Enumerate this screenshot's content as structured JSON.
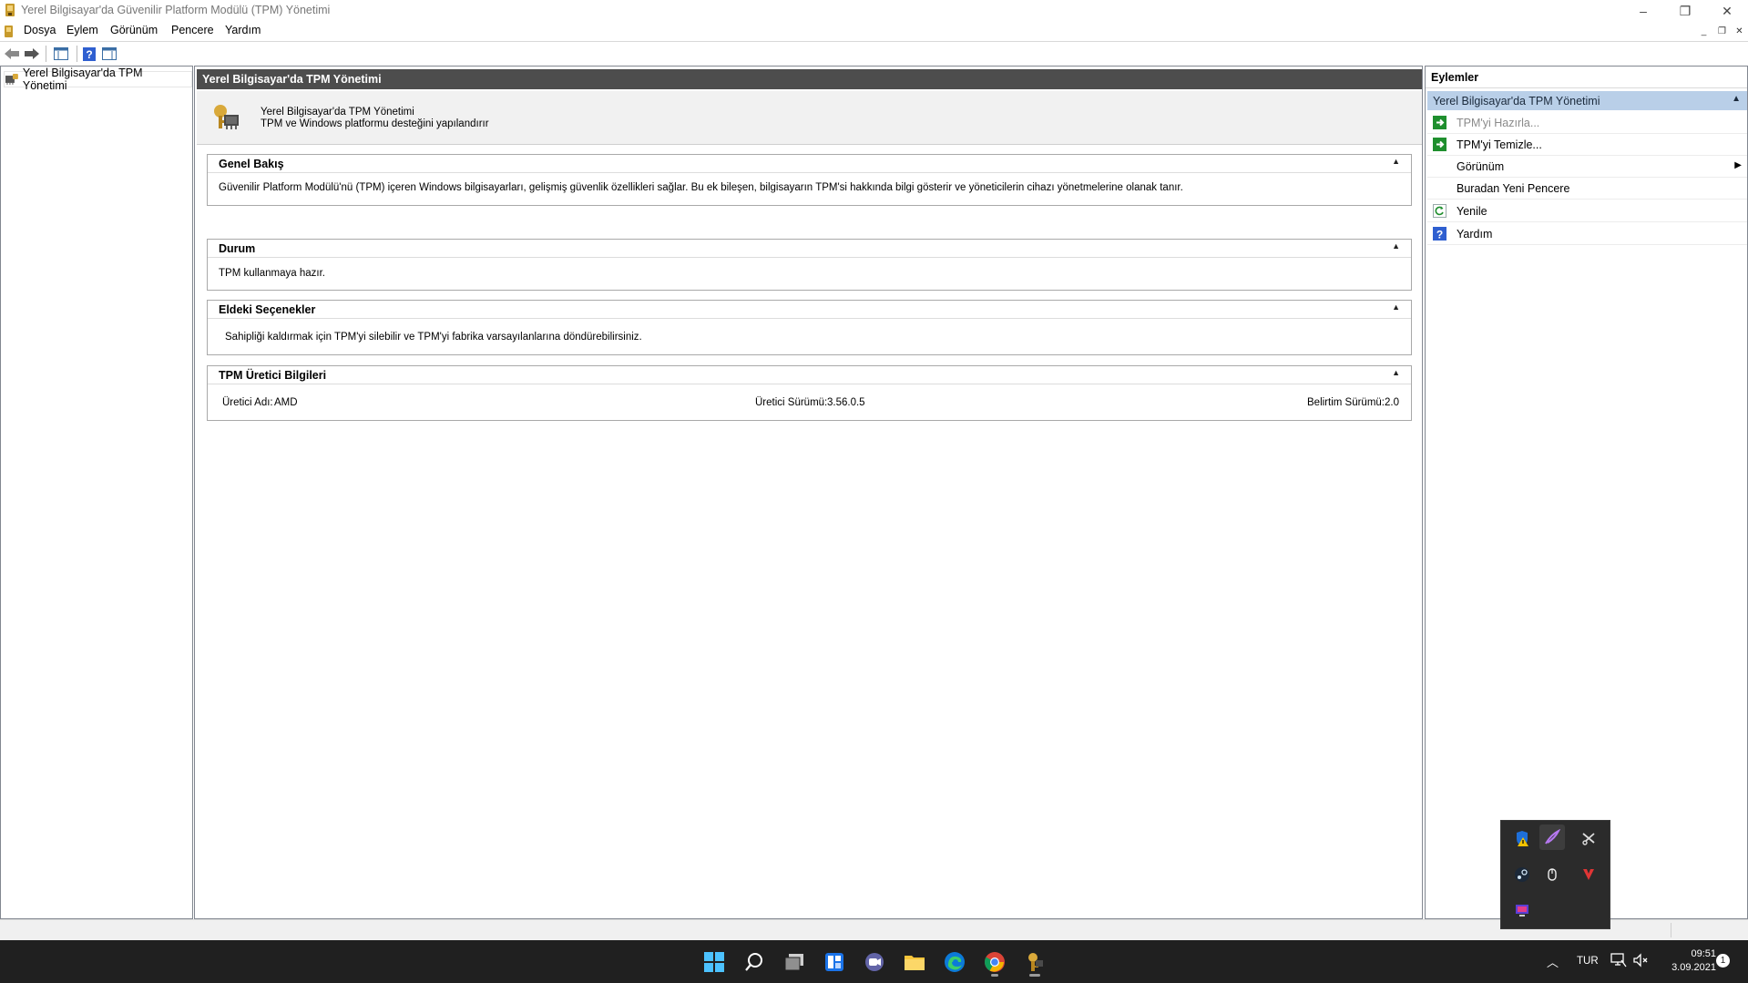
{
  "window": {
    "title": "Yerel Bilgisayar'da Güvenilir Platform Modülü (TPM) Yönetimi",
    "controls": {
      "minimize": "–",
      "restore": "❐",
      "close": "✕"
    }
  },
  "menu": {
    "items": [
      "Dosya",
      "Eylem",
      "Görünüm",
      "Pencere",
      "Yardım"
    ],
    "mdi": {
      "minimize": "_",
      "restore": "❐",
      "close": "✕"
    }
  },
  "tree": {
    "root_label": "Yerel Bilgisayar'da TPM Yönetimi"
  },
  "center": {
    "header": "Yerel Bilgisayar'da TPM Yönetimi",
    "banner_title": "Yerel Bilgisayar'da TPM Yönetimi",
    "banner_subtitle": "TPM ve Windows platformu desteğini yapılandırır",
    "sections": {
      "overview": {
        "title": "Genel Bakış",
        "text": "Güvenilir Platform Modülü'nü (TPM) içeren Windows bilgisayarları, gelişmiş güvenlik özellikleri sağlar. Bu ek bileşen, bilgisayarın TPM'si hakkında bilgi gösterir ve yöneticilerin cihazı yönetmelerine olanak tanır."
      },
      "status": {
        "title": "Durum",
        "text": "TPM kullanmaya hazır."
      },
      "options": {
        "title": "Eldeki Seçenekler",
        "text": "Sahipliği kaldırmak için TPM'yi silebilir ve TPM'yi fabrika varsayılanlarına döndürebilirsiniz."
      },
      "manufacturer": {
        "title": "TPM Üretici Bilgileri",
        "name_label": "Üretici Adı:",
        "name_value": "AMD",
        "version_label": "Üretici Sürümü:",
        "version_value": "3.56.0.5",
        "spec_label": "Belirtim Sürümü:",
        "spec_value": "2.0"
      }
    }
  },
  "actions": {
    "title": "Eylemler",
    "group": "Yerel Bilgisayar'da TPM Yönetimi",
    "items": {
      "prepare": "TPM'yi Hazırla...",
      "clear": "TPM'yi Temizle...",
      "view": "Görünüm",
      "new_window": "Buradan Yeni Pencere",
      "refresh": "Yenile",
      "help": "Yardım"
    }
  },
  "tray": {
    "language": "TUR",
    "time": "09:51",
    "date": "3.09.2021",
    "notification_count": "1"
  },
  "colors": {
    "header_bg": "#4d4d4d",
    "action_group_bg": "#b9cfe8",
    "taskbar_bg": "#202020",
    "green_action": "#1f8f2e",
    "help_blue": "#2f5fd0"
  }
}
